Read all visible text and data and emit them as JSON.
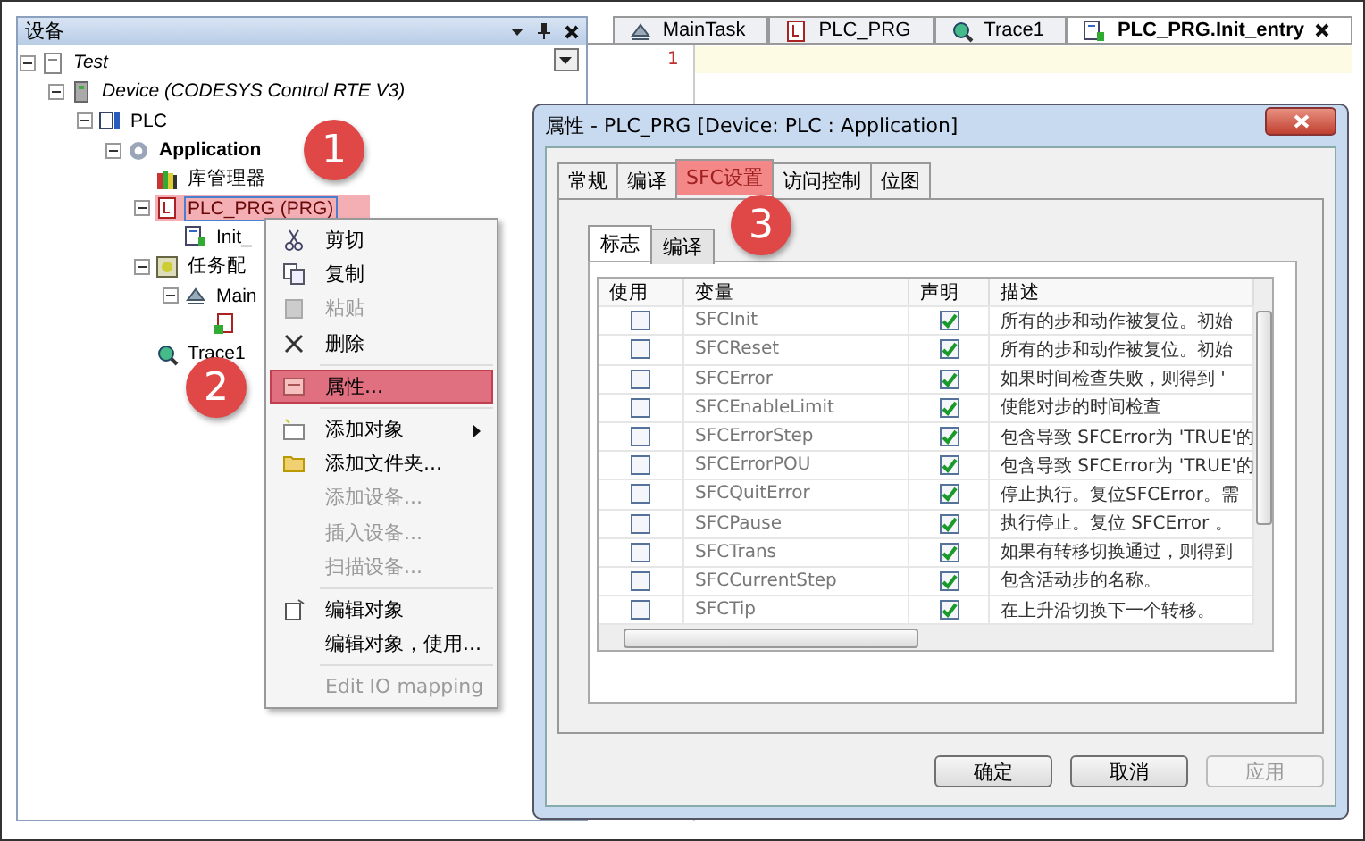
{
  "devices_panel": {
    "title": "设备",
    "tree": [
      {
        "label": "Test",
        "kind": "project",
        "italic": true,
        "expanded": true,
        "selected": false,
        "children": [
          {
            "label": "Device (CODESYS Control RTE V3)",
            "kind": "device",
            "italic": true,
            "expanded": true,
            "selected": false,
            "children": [
              {
                "label": "PLC",
                "kind": "plc",
                "expanded": true,
                "selected": false,
                "children": [
                  {
                    "label": "Application",
                    "kind": "application",
                    "bold": true,
                    "expanded": true,
                    "selected": false,
                    "children": [
                      {
                        "label": "库管理器",
                        "kind": "library",
                        "selected": false
                      },
                      {
                        "label": "PLC_PRG (PRG)",
                        "kind": "pou",
                        "expanded": true,
                        "selected": true,
                        "children": [
                          {
                            "label": "Init_",
                            "kind": "action",
                            "selected": false
                          }
                        ]
                      },
                      {
                        "label": "任务配",
                        "kind": "taskconfig",
                        "expanded": true,
                        "selected": false,
                        "children": [
                          {
                            "label": "Main",
                            "kind": "task",
                            "expanded": true,
                            "selected": false,
                            "children": [
                              {
                                "kind": "call",
                                "selected": false
                              }
                            ]
                          }
                        ]
                      },
                      {
                        "label": "Trace1",
                        "kind": "trace",
                        "selected": false
                      }
                    ]
                  }
                ]
              }
            ]
          }
        ]
      }
    ]
  },
  "editor": {
    "tabs": [
      {
        "label": "MainTask",
        "kind": "task",
        "selected": false
      },
      {
        "label": "PLC_PRG",
        "kind": "pou",
        "selected": false
      },
      {
        "label": "Trace1",
        "kind": "trace",
        "selected": false
      },
      {
        "label": "PLC_PRG.Init_entry",
        "kind": "action",
        "selected": true
      }
    ],
    "line_numbers": [
      "1"
    ]
  },
  "context_menu": [
    {
      "kind": "item",
      "label": "剪切",
      "disabled": false,
      "selected": false
    },
    {
      "kind": "item",
      "label": "复制",
      "disabled": false,
      "selected": false
    },
    {
      "kind": "item",
      "label": "粘贴",
      "disabled": true,
      "selected": false
    },
    {
      "kind": "item",
      "label": "删除",
      "disabled": false,
      "selected": false
    },
    {
      "kind": "separator"
    },
    {
      "kind": "item",
      "label": "属性...",
      "disabled": false,
      "selected": true
    },
    {
      "kind": "separator"
    },
    {
      "kind": "submenu",
      "label": "添加对象",
      "disabled": false,
      "selected": false
    },
    {
      "kind": "item",
      "label": "添加文件夹...",
      "disabled": false,
      "selected": false
    },
    {
      "kind": "item",
      "label": "添加设备...",
      "disabled": true,
      "selected": false
    },
    {
      "kind": "item",
      "label": "插入设备...",
      "disabled": true,
      "selected": false
    },
    {
      "kind": "item",
      "label": "扫描设备...",
      "disabled": true,
      "selected": false
    },
    {
      "kind": "separator"
    },
    {
      "kind": "item",
      "label": "编辑对象",
      "disabled": false,
      "selected": false
    },
    {
      "kind": "item",
      "label": "编辑对象，使用...",
      "disabled": false,
      "selected": false
    },
    {
      "kind": "separator"
    },
    {
      "kind": "item",
      "label": "Edit IO mapping",
      "disabled": true,
      "selected": false
    }
  ],
  "dialog": {
    "title": "属性 - PLC_PRG [Device: PLC : Application]",
    "tabs": [
      {
        "label": "常规",
        "selected": false
      },
      {
        "label": "编译",
        "selected": false
      },
      {
        "label": "SFC设置",
        "selected": true
      },
      {
        "label": "访问控制",
        "selected": false
      },
      {
        "label": "位图",
        "selected": false
      }
    ],
    "subtabs": [
      {
        "label": "标志",
        "selected": true
      },
      {
        "label": "编译",
        "selected": false
      }
    ],
    "table": {
      "columns": [
        "使用",
        "变量",
        "声明",
        "描述"
      ],
      "rows": [
        {
          "use": false,
          "variable": "SFCInit",
          "declare": true,
          "description": "所有的步和动作被复位。初始"
        },
        {
          "use": false,
          "variable": "SFCReset",
          "declare": true,
          "description": "所有的步和动作被复位。初始"
        },
        {
          "use": false,
          "variable": "SFCError",
          "declare": true,
          "description": "如果时间检查失败，则得到 '"
        },
        {
          "use": false,
          "variable": "SFCEnableLimit",
          "declare": true,
          "description": "使能对步的时间检查"
        },
        {
          "use": false,
          "variable": "SFCErrorStep",
          "declare": true,
          "description": "包含导致 SFCError为 'TRUE'的"
        },
        {
          "use": false,
          "variable": "SFCErrorPOU",
          "declare": true,
          "description": "包含导致 SFCError为 'TRUE'的"
        },
        {
          "use": false,
          "variable": "SFCQuitError",
          "declare": true,
          "description": "停止执行。复位SFCError。需"
        },
        {
          "use": false,
          "variable": "SFCPause",
          "declare": true,
          "description": "执行停止。复位 SFCError 。"
        },
        {
          "use": false,
          "variable": "SFCTrans",
          "declare": true,
          "description": "如果有转移切换通过，则得到"
        },
        {
          "use": false,
          "variable": "SFCCurrentStep",
          "declare": true,
          "description": "包含活动步的名称。"
        },
        {
          "use": false,
          "variable": "SFCTip",
          "declare": true,
          "description": "在上升沿切换下一个转移。"
        }
      ]
    },
    "buttons": [
      {
        "label": "确定",
        "disabled": false
      },
      {
        "label": "取消",
        "disabled": false
      },
      {
        "label": "应用",
        "disabled": true
      }
    ]
  },
  "step_markers": [
    "1",
    "2",
    "3"
  ]
}
